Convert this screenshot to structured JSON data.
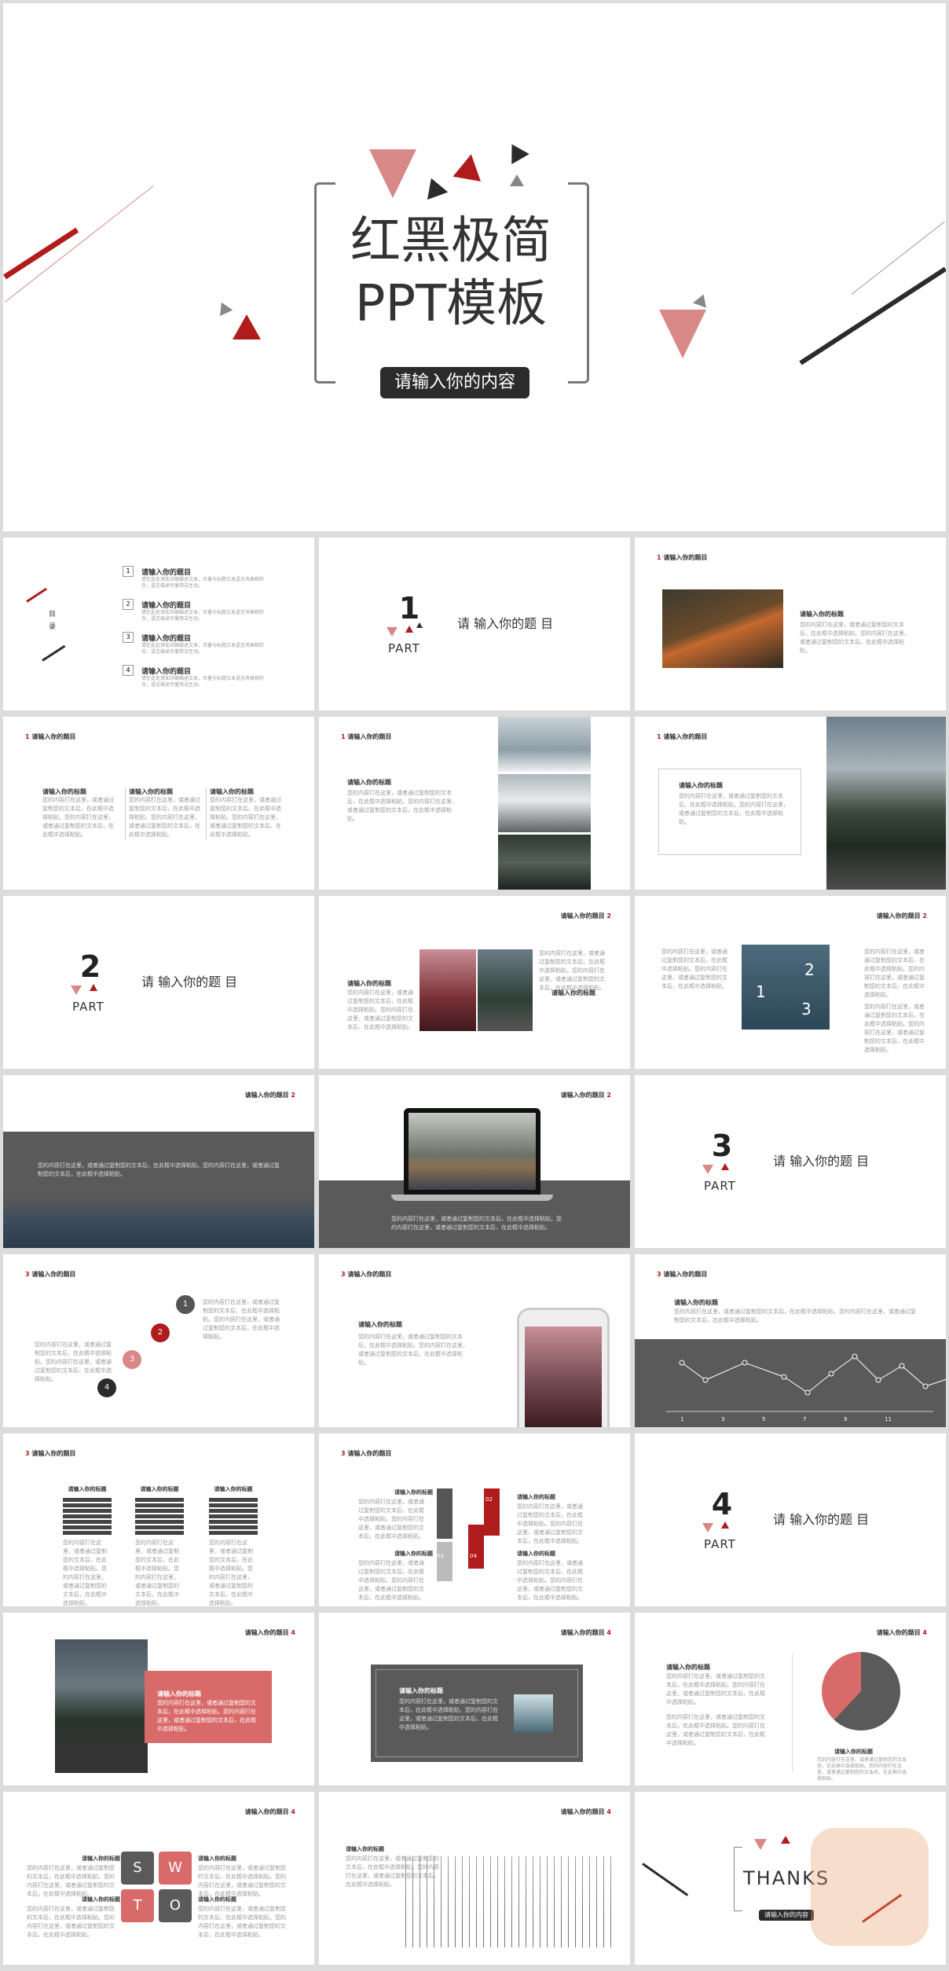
{
  "cover": {
    "title_line1": "红黑极简",
    "title_line2": "PPT模板",
    "subtitle": "请输入你的内容"
  },
  "toc": {
    "label": "目录",
    "items": [
      {
        "num": "1",
        "title": "请输入你的题目"
      },
      {
        "num": "2",
        "title": "请输入你的题目"
      },
      {
        "num": "3",
        "title": "请输入你的题目"
      },
      {
        "num": "4",
        "title": "请输入你的题目"
      }
    ],
    "body": "请在此处添加详细描述文本，尽量与标题文本语言风格相符合，语言描述尽量简洁生动。"
  },
  "part_label": "PART",
  "part_title": "请 输入你的题 目",
  "parts": [
    "1",
    "2",
    "3",
    "4"
  ],
  "section_header": "请输入你的题目",
  "subtitle": "请输入你的标题",
  "body": "您的内容打在这里，或者通过复制您的文本后，在此框中选择粘贴。您的内容打在这里，或者通过复制您的文本后，在此框中选择粘贴。",
  "cycle_numbers": [
    "1",
    "2",
    "3"
  ],
  "timeline_numbers": [
    "1",
    "2",
    "3",
    "4"
  ],
  "arrow_numbers": [
    "01",
    "02",
    "03",
    "04"
  ],
  "swot": [
    "S",
    "W",
    "T",
    "O"
  ],
  "line_chart_x": [
    "1",
    "3",
    "5",
    "7",
    "9",
    "11"
  ],
  "thanks": {
    "title": "THANKS",
    "subtitle": "请输入你的内容"
  },
  "colors": {
    "accent": "#b01b1b",
    "pink": "#d98888",
    "dark": "#2b2b2b",
    "gray": "#5a5a5a"
  }
}
